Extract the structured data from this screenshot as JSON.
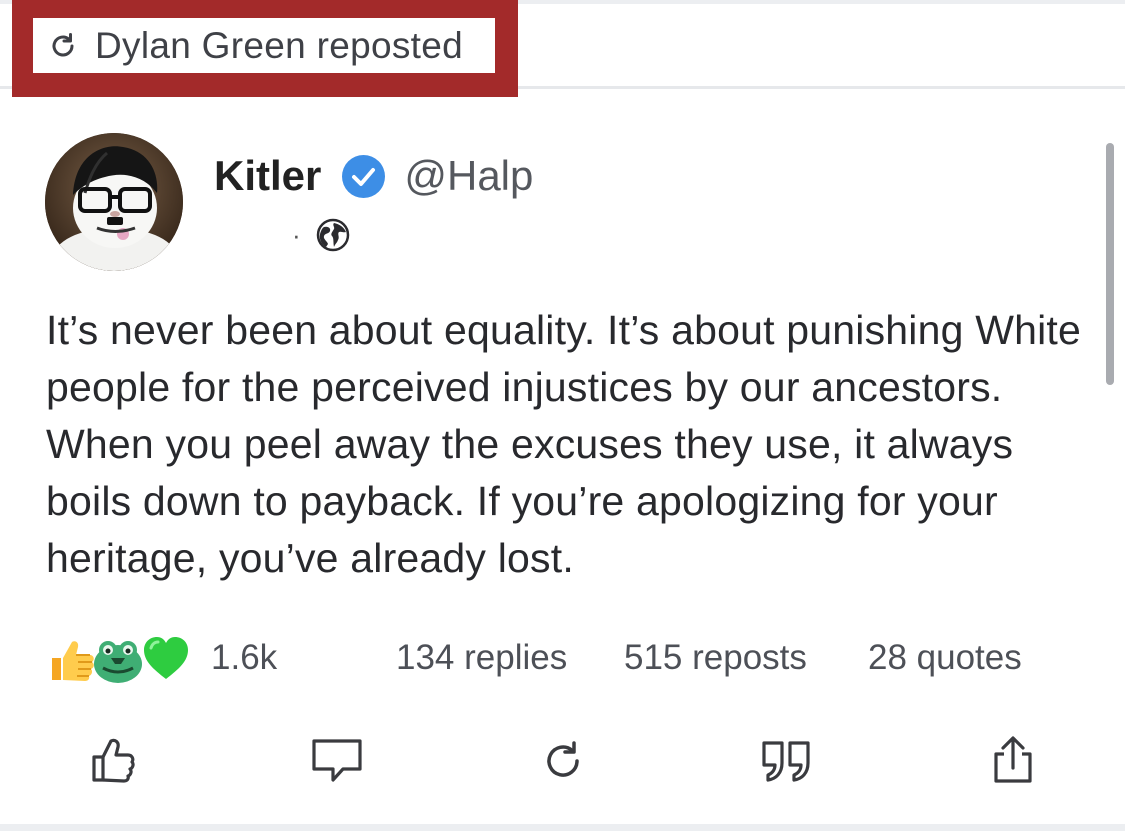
{
  "repost": {
    "label": "Dylan Green reposted",
    "icon": "repost-icon",
    "highlight_color": "#a32a2a"
  },
  "post": {
    "author": {
      "display_name": "Kitler",
      "verified": true,
      "handle": "@Halp",
      "avatar": "cat-avatar"
    },
    "meta": {
      "time": "",
      "separator": "·",
      "visibility_icon": "globe-icon"
    },
    "text": "It’s never been about equality. It’s about punishing White people for the perceived injustices by our ancestors. When you peel away the excuses they use, it always boils down to payback. If you’re apologizing for your heritage, you’ve already lost.",
    "reactions": {
      "icons": [
        "thumbs-up-emoji",
        "frog-emoji",
        "green-heart-emoji"
      ],
      "count": "1.6k"
    },
    "stats": {
      "replies": "134 replies",
      "reposts": "515 reposts",
      "quotes": "28 quotes"
    }
  },
  "actions": [
    {
      "name": "like",
      "icon": "thumbs-up-icon"
    },
    {
      "name": "reply",
      "icon": "comment-icon"
    },
    {
      "name": "repost",
      "icon": "repost-icon"
    },
    {
      "name": "quote",
      "icon": "quote-icon"
    },
    {
      "name": "share",
      "icon": "share-icon"
    }
  ],
  "colors": {
    "verified": "#3d8ee6",
    "text": "#28292d",
    "muted": "#4d5057"
  }
}
